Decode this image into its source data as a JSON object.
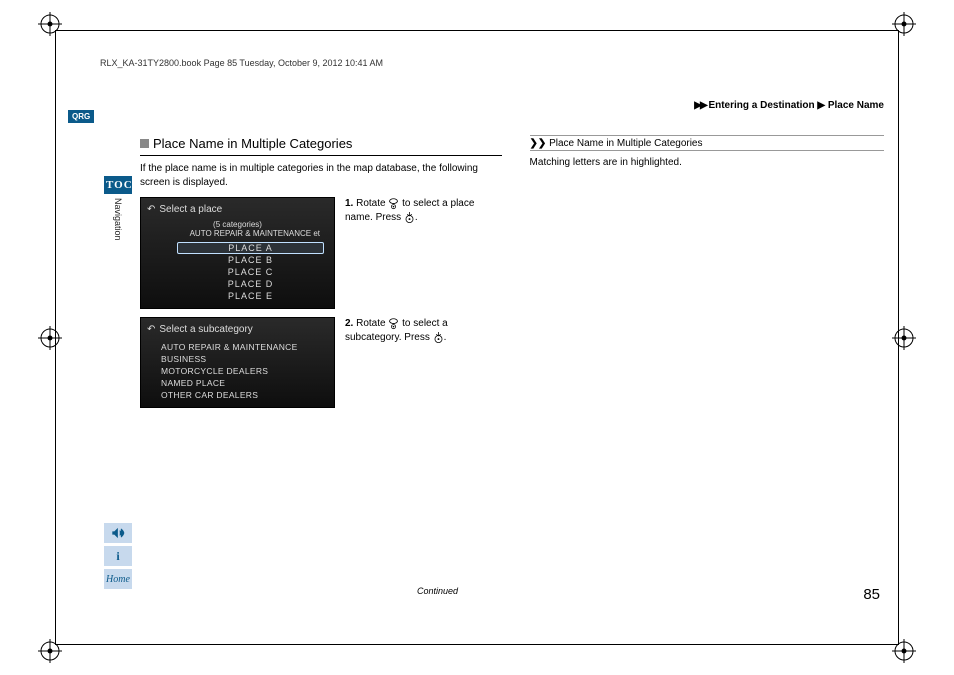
{
  "header": {
    "bookline": "RLX_KA-31TY2800.book  Page 85  Tuesday, October 9, 2012  10:41 AM"
  },
  "breadcrumb": {
    "arrows": "▶▶",
    "seg1": "Entering a Destination",
    "sep": "▶",
    "seg2": "Place Name"
  },
  "qrg": "QRG",
  "toc": {
    "label": "TOC",
    "section": "Navigation"
  },
  "sideButtons": {
    "voice": "⇪",
    "info": "i",
    "home": "Home"
  },
  "section": {
    "title": "Place Name in Multiple Categories",
    "intro": "If the place name is in multiple categories in the map database, the following screen is displayed."
  },
  "screens": {
    "s1": {
      "header": "Select a place",
      "count": "(5 categories)",
      "meta": "AUTO REPAIR & MAINTENANCE et",
      "items": [
        "PLACE A",
        "PLACE B",
        "PLACE C",
        "PLACE D",
        "PLACE E"
      ]
    },
    "s2": {
      "header": "Select a subcategory",
      "items": [
        "AUTO REPAIR & MAINTENANCE",
        "BUSINESS",
        "MOTORCYCLE DEALERS",
        "NAMED PLACE",
        "OTHER CAR DEALERS"
      ]
    }
  },
  "steps": {
    "n1": "1.",
    "t1a": "Rotate ",
    "t1b": " to select a place name. Press ",
    "t1c": ".",
    "n2": "2.",
    "t2a": "Rotate ",
    "t2b": " to select a subcategory. Press ",
    "t2c": "."
  },
  "sidenote": {
    "marker": "❯❯",
    "title": "Place Name in Multiple Categories",
    "body": "Matching letters are in highlighted."
  },
  "footer": {
    "continued": "Continued",
    "page": "85"
  }
}
